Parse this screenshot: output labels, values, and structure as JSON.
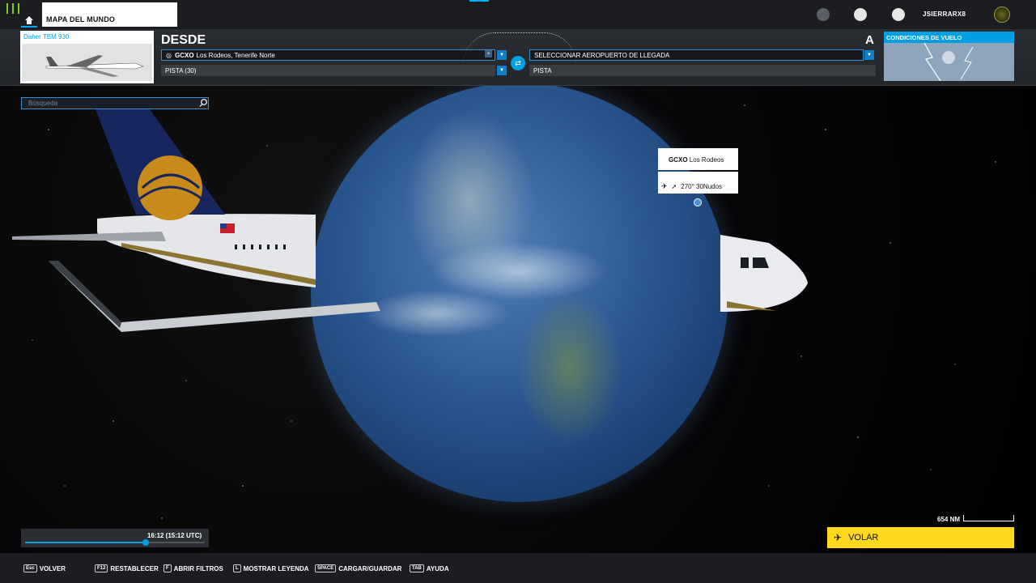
{
  "header": {
    "map_tab_label": "MAPA DEL MUNDO",
    "username": "JSIERRARX8",
    "icons": [
      "logo-bars-icon",
      "home-icon",
      "friends-icon",
      "profile-icon",
      "notifications-icon",
      "avatar"
    ]
  },
  "aircraft": {
    "brand": "Daher",
    "model": "TBM 930"
  },
  "departure": {
    "section_label": "DESDE",
    "airport_code": "GCXO",
    "airport_name": "Los Rodeos, Tenerife Norte",
    "runway": "PISTA (30)"
  },
  "arrival": {
    "section_label": "A",
    "airport_placeholder": "SELECCIONAR AEROPUERTO DE LLEGADA",
    "runway": "PISTA"
  },
  "weather": {
    "label": "CONDICIONES DE VUELO"
  },
  "search": {
    "placeholder": "Búsqueda"
  },
  "map_tooltip": {
    "code": "GCXO",
    "name": "Los Rodeos",
    "wind": "270° 30Nudos"
  },
  "time": {
    "label": "16:12 (15:12 UTC)",
    "fraction": 0.67
  },
  "scale": {
    "label": "654 NM"
  },
  "fly_button": {
    "label": "VOLAR"
  },
  "bottom_bar": [
    {
      "key": "Esc",
      "label": "VOLVER"
    },
    {
      "key": "F12",
      "label": "RESTABLECER"
    },
    {
      "key": "F",
      "label": "ABRIR FILTROS"
    },
    {
      "key": "L",
      "label": "MOSTRAR LEYENDA"
    },
    {
      "key": "SPACE",
      "label": "CARGAR/GUARDAR"
    },
    {
      "key": "TAB",
      "label": "AYUDA"
    }
  ],
  "colors": {
    "accent": "#009fe3",
    "fly": "#ffd81f",
    "bar": "#1b1d21"
  }
}
